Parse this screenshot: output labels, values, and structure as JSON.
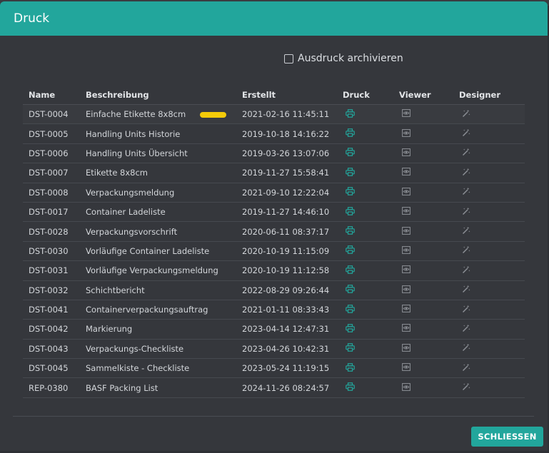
{
  "dialog": {
    "title": "Druck",
    "archive_label": "Ausdruck archivieren",
    "archive_checked": false,
    "close_label": "SCHLIESSEN"
  },
  "table": {
    "columns": {
      "name": "Name",
      "description": "Beschreibung",
      "created": "Erstellt",
      "print": "Druck",
      "viewer": "Viewer",
      "designer": "Designer"
    },
    "rows": [
      {
        "name": "DST-0004",
        "description": "Einfache Etikette 8x8cm",
        "created": "2021-02-16 11:45:11"
      },
      {
        "name": "DST-0005",
        "description": "Handling Units Historie",
        "created": "2019-10-18 14:16:22"
      },
      {
        "name": "DST-0006",
        "description": "Handling Units Übersicht",
        "created": "2019-03-26 13:07:06"
      },
      {
        "name": "DST-0007",
        "description": "Etikette 8x8cm",
        "created": "2019-11-27 15:58:41"
      },
      {
        "name": "DST-0008",
        "description": "Verpackungsmeldung",
        "created": "2021-09-10 12:22:04"
      },
      {
        "name": "DST-0017",
        "description": "Container Ladeliste",
        "created": "2019-11-27 14:46:10"
      },
      {
        "name": "DST-0028",
        "description": "Verpackungsvorschrift",
        "created": "2020-06-11 08:37:17"
      },
      {
        "name": "DST-0030",
        "description": "Vorläufige Container Ladeliste",
        "created": "2020-10-19 11:15:09"
      },
      {
        "name": "DST-0031",
        "description": "Vorläufige Verpackungsmeldung",
        "created": "2020-10-19 11:12:58"
      },
      {
        "name": "DST-0032",
        "description": "Schichtbericht",
        "created": "2022-08-29 09:26:44"
      },
      {
        "name": "DST-0041",
        "description": "Containerverpackungsauftrag",
        "created": "2021-01-11 08:33:43"
      },
      {
        "name": "DST-0042",
        "description": "Markierung",
        "created": "2023-04-14 12:47:31"
      },
      {
        "name": "DST-0043",
        "description": "Verpackungs-Checkliste",
        "created": "2023-04-26 10:42:31"
      },
      {
        "name": "DST-0045",
        "description": "Sammelkiste - Checkliste",
        "created": "2023-05-24 11:19:15"
      },
      {
        "name": "REP-0380",
        "description": "BASF Packing List",
        "created": "2024-11-26 08:24:57"
      }
    ]
  },
  "icons": {
    "print": "printer-icon",
    "viewer": "eye-icon",
    "designer": "magic-wand-icon"
  },
  "colors": {
    "accent": "#22a69c",
    "highlight": "#f4cb09",
    "background": "#35373c"
  }
}
